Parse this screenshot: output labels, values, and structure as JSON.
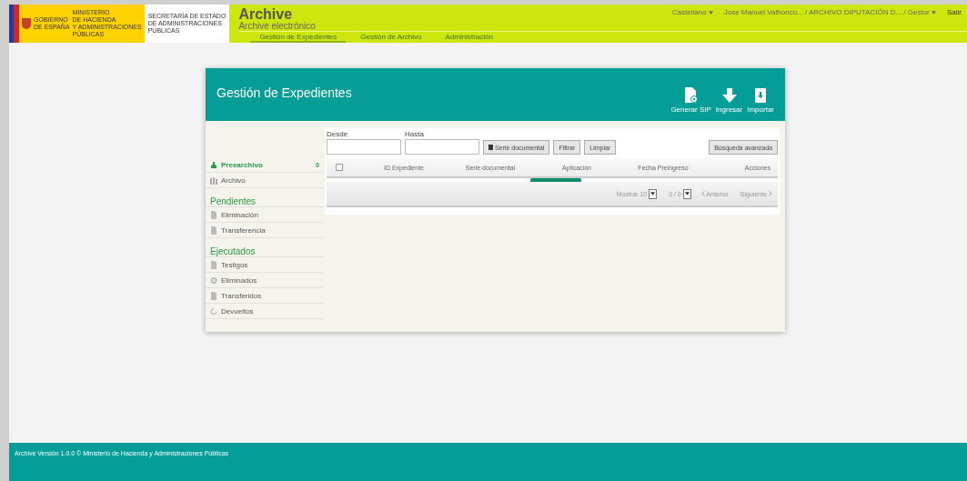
{
  "logo": {
    "lines_left": [
      "GOBIERNO",
      "DE ESPAÑA"
    ],
    "lines_ministry": [
      "MINISTERIO",
      "DE HACIENDA",
      "Y ADMINISTRACIONES",
      "PÚBLICAS"
    ],
    "lines_secretary": [
      "SECRETARÍA DE ESTADO",
      "DE ADMINISTRACIONES",
      "PÚBLICAS"
    ]
  },
  "app": {
    "title": "Archive",
    "subtitle": "Archive electrónico"
  },
  "nav": [
    {
      "label": "Gestión de Expedientes",
      "selected": true
    },
    {
      "label": "Gestión de Archivo",
      "selected": false
    },
    {
      "label": "Administración",
      "selected": false
    }
  ],
  "user_menu": {
    "language": "Castellano",
    "user": "Jose Manuel Valhonco... / ARCHIVO DIPUTACIÓN D... / Gestor",
    "logout": "Salir"
  },
  "card": {
    "title": "Gestión de Expedientes",
    "actions": [
      {
        "label": "Generar SIP",
        "kind": "gear"
      },
      {
        "label": "Ingresar",
        "kind": "arrow"
      },
      {
        "label": "Importar",
        "kind": "import"
      }
    ]
  },
  "sidebar": [
    {
      "kind": "item",
      "label": "Preearchivo",
      "count": "0",
      "selected": true
    },
    {
      "kind": "item",
      "label": "Archivo",
      "selected": false
    },
    {
      "kind": "heading",
      "label": "Pendientes"
    },
    {
      "kind": "item",
      "label": "Eliminación",
      "selected": false
    },
    {
      "kind": "item",
      "label": "Transferencia",
      "selected": false
    },
    {
      "kind": "heading",
      "label": "Ejecutados"
    },
    {
      "kind": "item",
      "label": "Testigos",
      "selected": false
    },
    {
      "kind": "item",
      "label": "Eliminados",
      "selected": false
    },
    {
      "kind": "item",
      "label": "Transferidos",
      "selected": false
    },
    {
      "kind": "item",
      "label": "Devueltos",
      "selected": false
    }
  ],
  "filters": {
    "from_label": "Desde",
    "to_label": "Hasta",
    "serie_button": "Serie documental",
    "filter_button": "Filtrar",
    "clear_button": "Limpiar",
    "advanced_button": "Búsqueda avanzada"
  },
  "table": {
    "select_all": {
      "checked": false
    },
    "columns": [
      "ID Expediente",
      "Serie documental",
      "Aplicación",
      "Fecha Preingreso",
      "Acciones"
    ]
  },
  "pager": {
    "show_label": "Mostrar",
    "page_size": "10",
    "page": "0 / 0",
    "prev": "Anterior",
    "next": "Siguiente"
  },
  "footer": "Archive Versión 1.0.0 © Ministerio de Hacienda y Administraciones Públicas"
}
